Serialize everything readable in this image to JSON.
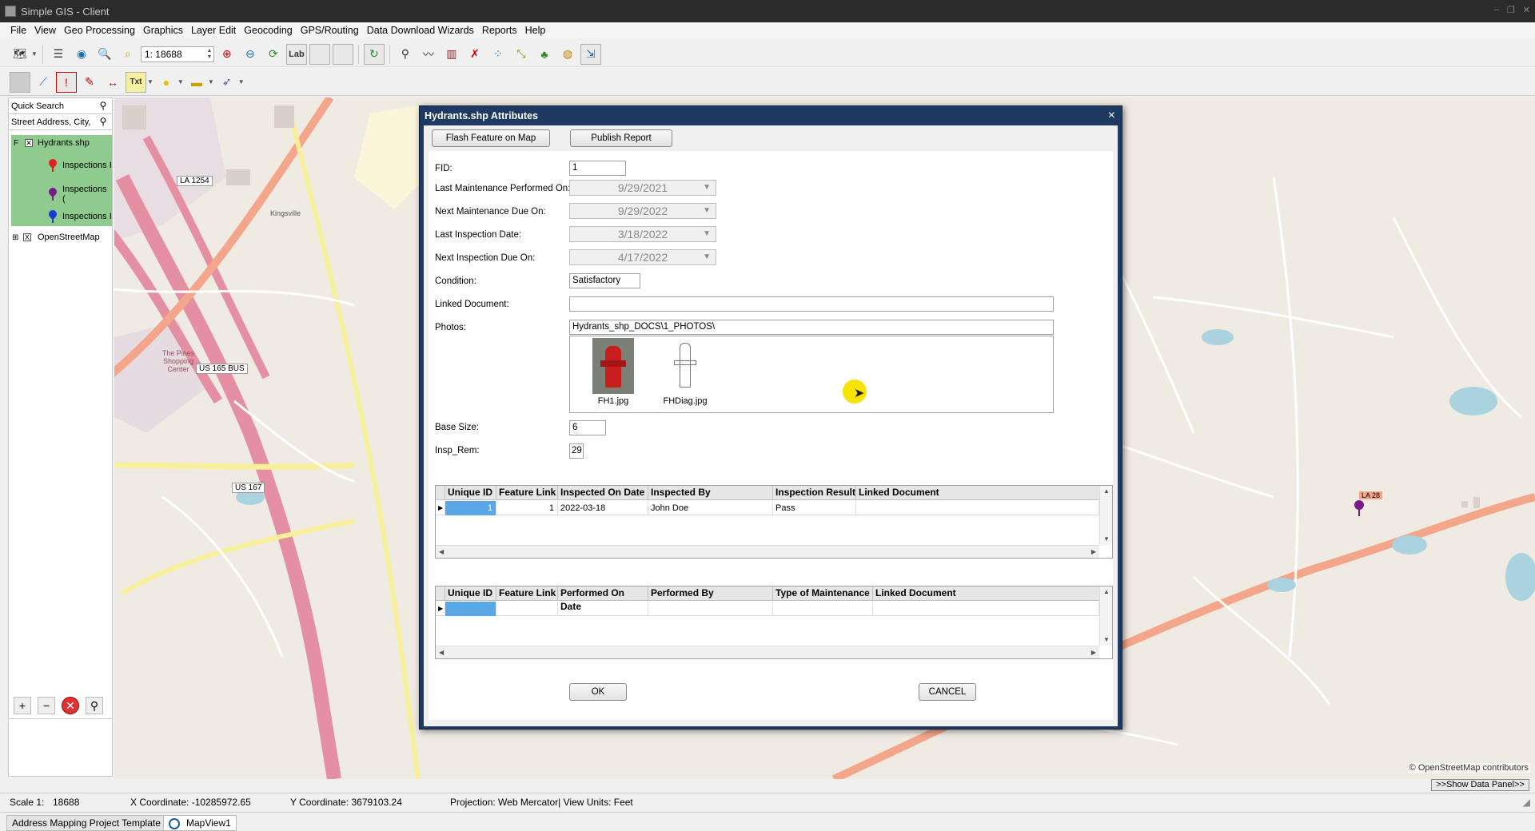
{
  "window": {
    "title": "Simple GIS - Client"
  },
  "menu": [
    "File",
    "View",
    "Geo Processing",
    "Graphics",
    "Layer Edit",
    "Geocoding",
    "GPS/Routing",
    "Data Download Wizards",
    "Reports",
    "Help"
  ],
  "toolbar": {
    "scale_value": "1: 18688",
    "lab_label": "Lab",
    "txt_label": "Txt"
  },
  "left_panel": {
    "quick_search": "Quick Search",
    "address_search": "Street Address, City,",
    "layers": {
      "hydrants": {
        "name": "Hydrants.shp",
        "check": "F"
      },
      "sublayers": [
        {
          "label": "Inspections I",
          "color": "#e02020"
        },
        {
          "label": "Inspections (",
          "color": "#7a1a8a"
        },
        {
          "label": "Inspections I",
          "color": "#1a3ad8"
        }
      ],
      "osm": {
        "name": "OpenStreetMap",
        "check": "X"
      }
    }
  },
  "map": {
    "attribution": "© OpenStreetMap contributors",
    "show_data_panel": ">>Show Data Panel>>",
    "labels": {
      "la1254": "LA 1254",
      "us165bus": "US 165 BUS",
      "us167": "US 167",
      "la28": "LA 28",
      "pines": "The Pines Shopping Center",
      "kingsville": "Kingsville"
    }
  },
  "dialog": {
    "title": "Hydrants.shp Attributes",
    "flash_button": "Flash Feature on Map",
    "publish_button": "Publish Report",
    "fields": {
      "fid_label": "FID:",
      "fid_value": "1",
      "last_maint_label": "Last Maintenance Performed On:",
      "last_maint_value": "9/29/2021",
      "next_maint_label": "Next Maintenance Due On:",
      "next_maint_value": "9/29/2022",
      "last_insp_label": "Last Inspection Date:",
      "last_insp_value": "3/18/2022",
      "next_insp_label": "Next Inspection Due On:",
      "next_insp_value": "4/17/2022",
      "condition_label": "Condition:",
      "condition_value": "Satisfactory",
      "linked_doc_label": "Linked Document:",
      "linked_doc_value": "",
      "photos_label": "Photos:",
      "photos_value": "Hydrants_shp_DOCS\\1_PHOTOS\\",
      "base_size_label": "Base Size:",
      "base_size_value": "6",
      "insp_rem_label": "Insp_Rem:",
      "insp_rem_value": "29"
    },
    "photos": [
      {
        "name": "FH1.jpg"
      },
      {
        "name": "FHDiag.jpg"
      }
    ],
    "inspections_table": {
      "columns": [
        "Unique ID",
        "Feature Link",
        "Inspected On Date",
        "Inspected By",
        "Inspection Result",
        "Linked Document"
      ],
      "rows": [
        [
          "1",
          "1",
          "2022-03-18",
          "John Doe",
          "Pass",
          ""
        ]
      ]
    },
    "maintenance_table": {
      "columns": [
        "Unique ID",
        "Feature Link",
        "Performed On Date",
        "Performed By",
        "Type of Maintenance",
        "Linked Document"
      ],
      "rows": []
    },
    "ok_label": "OK",
    "cancel_label": "CANCEL",
    "close_glyph": "×"
  },
  "status": {
    "scale_label": "Scale 1:",
    "scale_value": "18688",
    "x_coord": "X Coordinate: -10285972.65",
    "y_coord": "Y Coordinate: 3679103.24",
    "projection": "Projection: Web Mercator| View Units: Feet"
  },
  "tabs": {
    "project": "Address Mapping Project Template",
    "mapview": "MapView1"
  }
}
